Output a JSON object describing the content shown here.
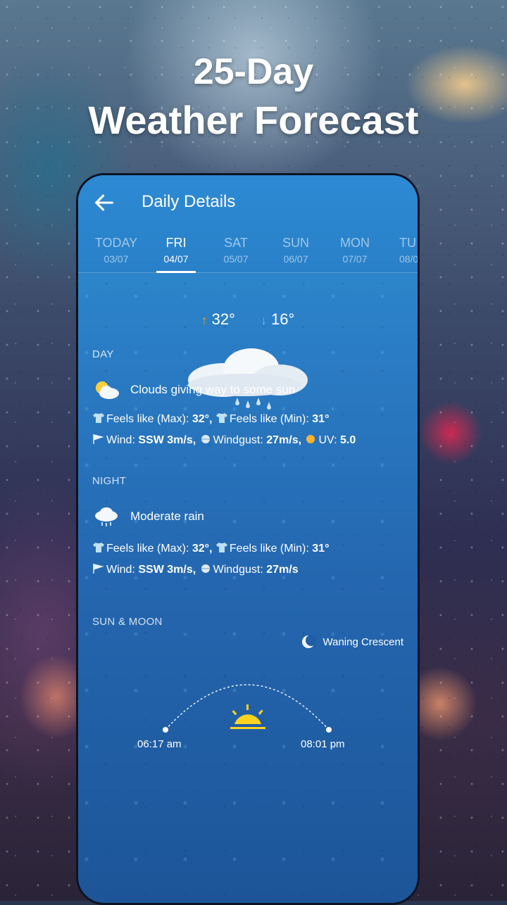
{
  "promo": {
    "line1": "25-Day",
    "line2": "Weather Forecast"
  },
  "header": {
    "title": "Daily Details",
    "back_icon": "arrow-left-icon"
  },
  "tabs": [
    {
      "name": "TODAY",
      "date": "03/07"
    },
    {
      "name": "FRI",
      "date": "04/07",
      "active": true
    },
    {
      "name": "SAT",
      "date": "05/07"
    },
    {
      "name": "SUN",
      "date": "06/07"
    },
    {
      "name": "MON",
      "date": "07/07"
    },
    {
      "name": "TU",
      "date": "08/0"
    }
  ],
  "temps": {
    "max": "32°",
    "min": "16°"
  },
  "day": {
    "label": "DAY",
    "condition": "Clouds giving way to some sun",
    "feels_max_label": "Feels like (Max):",
    "feels_max": "32°,",
    "feels_min_label": "Feels like (Min):",
    "feels_min": "31°",
    "wind_label": "Wind:",
    "wind": "SSW 3m/s,",
    "gust_label": "Windgust:",
    "gust": "27m/s,",
    "uv_label": "UV:",
    "uv": "5.0"
  },
  "night": {
    "label": "NIGHT",
    "condition": "Moderate rain",
    "feels_max_label": "Feels like (Max):",
    "feels_max": "32°,",
    "feels_min_label": "Feels like (Min):",
    "feels_min": "31°",
    "wind_label": "Wind:",
    "wind": "SSW 3m/s,",
    "gust_label": "Windgust:",
    "gust": "27m/s"
  },
  "sun_moon": {
    "label": "SUN & MOON",
    "moon_phase": "Waning Crescent",
    "sunrise": "06:17 am",
    "sunset": "08:01 pm"
  },
  "colors": {
    "accent_max": "#f0a030",
    "accent_min": "#40d0e0",
    "sun": "#ffd21e"
  }
}
